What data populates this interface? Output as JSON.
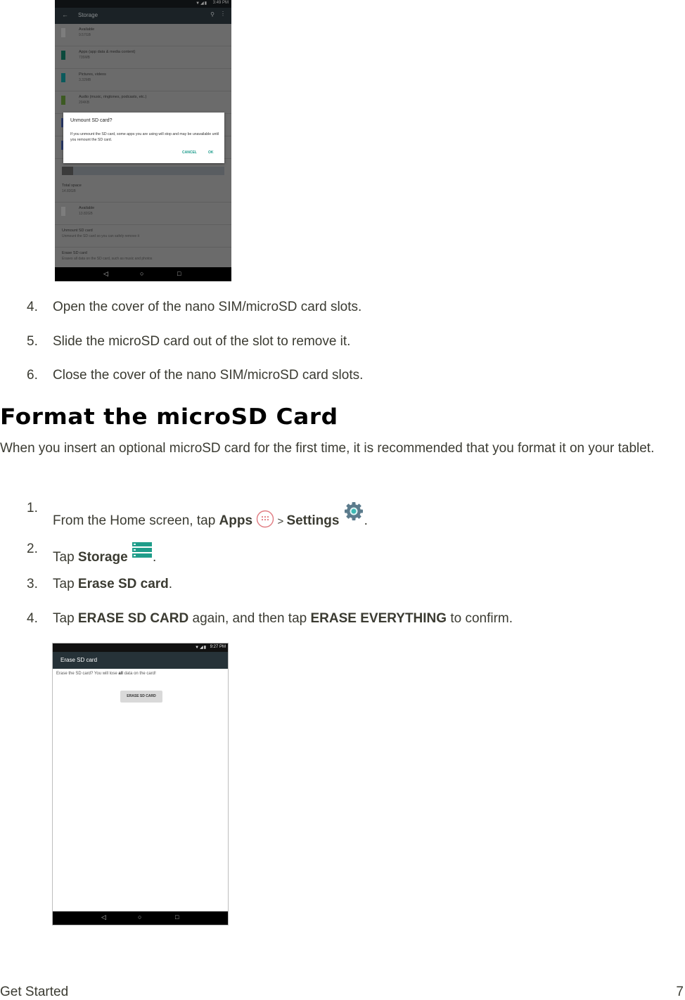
{
  "screenshot1": {
    "status_time": "3:49 PM",
    "status_icons": "▼◢▮",
    "title": "Storage",
    "rows": [
      {
        "label": "Available",
        "value": "9.57GB",
        "color": "#7d7d7d"
      },
      {
        "label": "Apps (app data & media content)",
        "value": "735MB",
        "color": "#0b4a3c"
      },
      {
        "label": "Pictures, videos",
        "value": "3.32MB",
        "color": "#0b5a5c"
      },
      {
        "label": "Audio (music, ringtones, podcasts, etc.)",
        "value": "204KB",
        "color": "#3c5a22"
      },
      {
        "label": "",
        "value": "",
        "color": "#2a3a6a"
      },
      {
        "label": "",
        "value": "",
        "color": "#2a3a6a"
      }
    ],
    "total_space_label": "Total space",
    "total_space_value": "14.83GB",
    "sd_available_label": "Available",
    "sd_available_value": "13.82GB",
    "unmount_label": "Unmount SD card",
    "unmount_desc": "Unmount the SD card so you can safely remove it",
    "erase_label": "Erase SD card",
    "erase_desc": "Erases all data on the SD card, such as music and photos",
    "dialog": {
      "title": "Unmount SD card?",
      "body": "If you unmount the SD card, some apps you are using will stop and may be unavailable until you remount the SD card.",
      "cancel": "CANCEL",
      "ok": "OK"
    }
  },
  "steps_a": [
    {
      "num": "4.",
      "text": "Open the cover of the nano SIM/microSD card slots."
    },
    {
      "num": "5.",
      "text": "Slide the microSD card out of the slot to remove it."
    },
    {
      "num": "6.",
      "text": "Close the cover of the nano SIM/microSD card slots."
    }
  ],
  "section": {
    "heading": "Format the microSD Card",
    "intro": "When you insert an optional microSD card for the first time, it is recommended that you format it on your tablet."
  },
  "steps_b": {
    "s1": {
      "num": "1.",
      "pre": "From the Home screen, tap ",
      "apps": "Apps",
      "sep": " > ",
      "settings": "Settings",
      "end": "."
    },
    "s2": {
      "num": "2.",
      "pre": "Tap ",
      "storage": "Storage",
      "end": "."
    },
    "s3": {
      "num": "3.",
      "pre": "Tap ",
      "bold": "Erase SD card",
      "end": "."
    },
    "s4": {
      "num": "4.",
      "pre": "Tap ",
      "bold1": "ERASE SD CARD",
      "mid": " again, and then tap ",
      "bold2": "ERASE EVERYTHING",
      "end": " to confirm."
    }
  },
  "icons": {
    "apps_color": "#e07a80",
    "settings_color": "#5b7b8c",
    "storage_color": "#1f9d8a"
  },
  "screenshot2": {
    "status_time": "9:27 PM",
    "status_icons": "▼◢▮",
    "title": "Erase SD card",
    "msg_pre": "Erase the SD card? You will lose ",
    "msg_bold": "all",
    "msg_post": " data on the card!",
    "button": "ERASE SD CARD"
  },
  "nav": {
    "back": "◁",
    "home": "○",
    "recents": "□"
  },
  "footer": {
    "section": "Get Started",
    "page": "7"
  }
}
